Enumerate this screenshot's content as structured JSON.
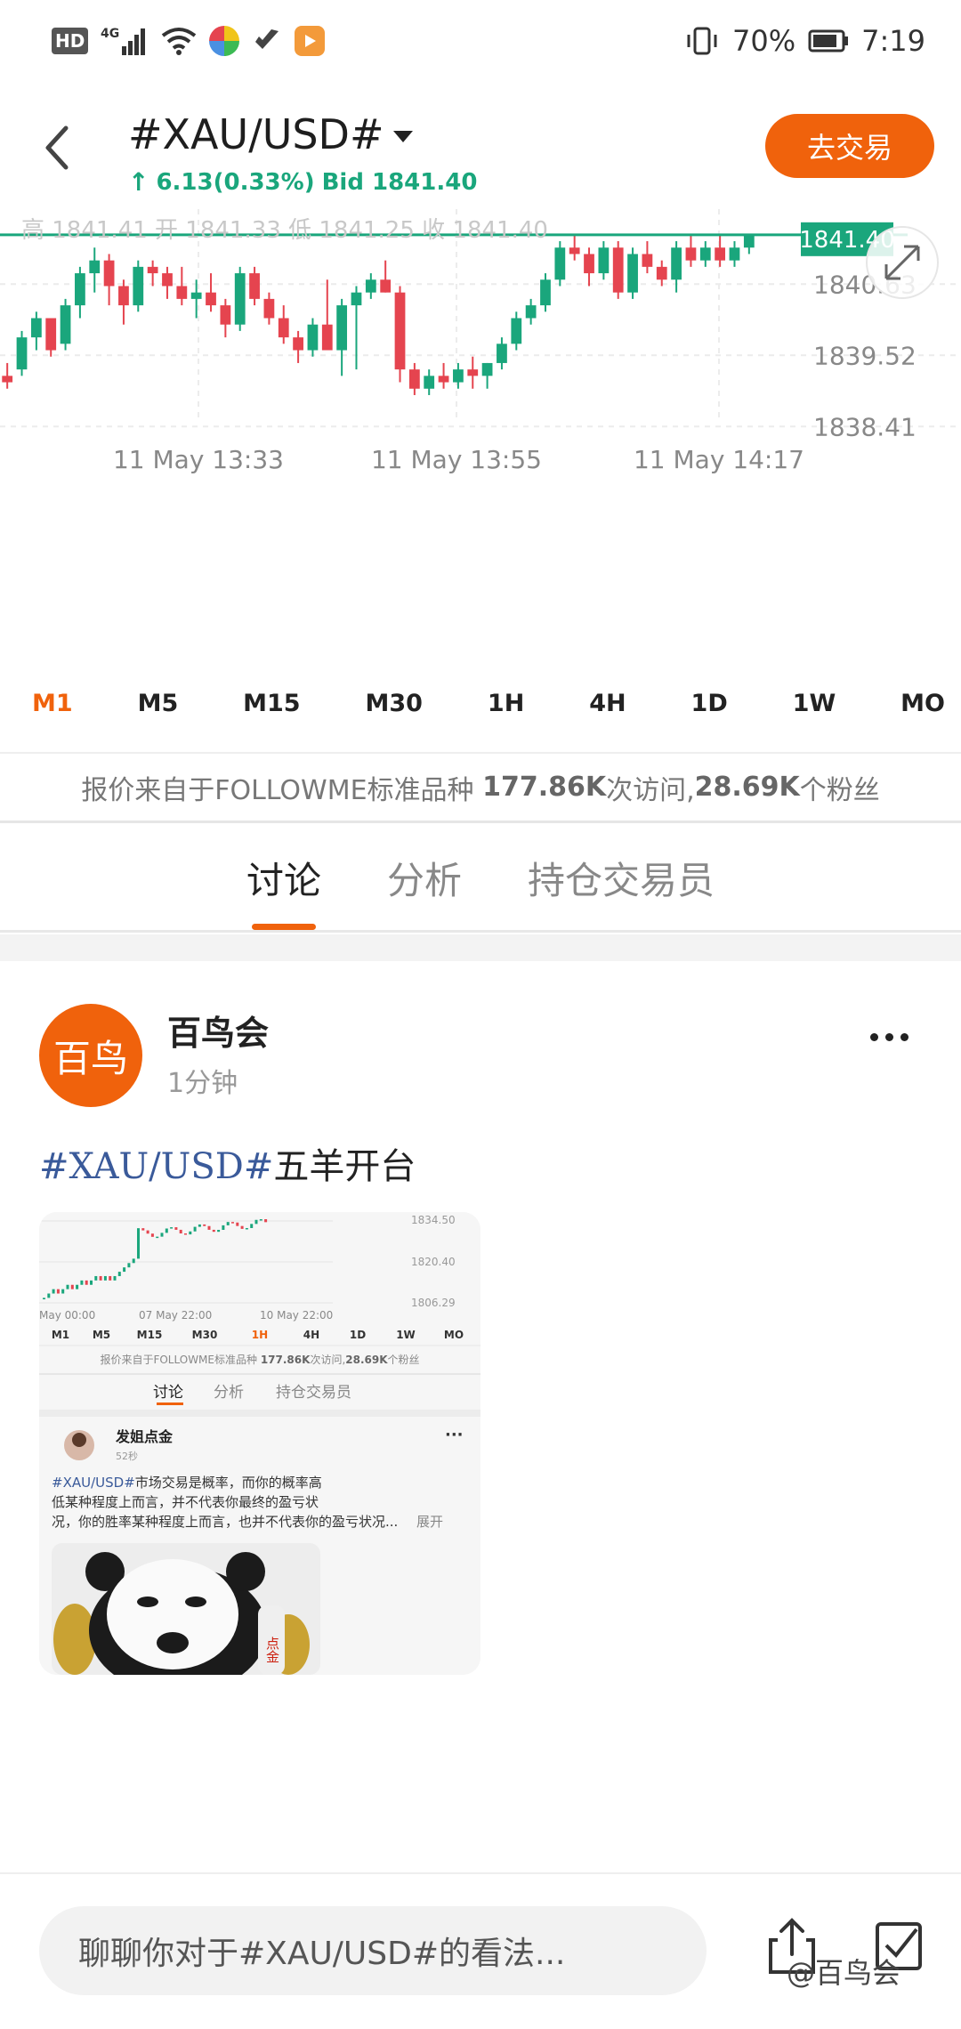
{
  "status_bar": {
    "network": "4G",
    "battery": "70%",
    "time": "7:19",
    "hd_label": "HD"
  },
  "header": {
    "title": "#XAU/USD#",
    "change": "6.13(0.33%)",
    "bid": "Bid 1841.40",
    "trade_button": "去交易"
  },
  "chart_data": {
    "type": "candlestick",
    "ohlc_label": "高 1841.41  开 1841.33  低 1841.25  收 1841.40",
    "current_price": "1841.40",
    "y_ticks": [
      "1840.63",
      "1839.52",
      "1838.41"
    ],
    "x_ticks": [
      "11 May  13:33",
      "11 May  13:55",
      "11 May  14:17"
    ],
    "ylim": [
      1838.4,
      1841.8
    ],
    "candles": [
      [
        1839.2,
        1839.4,
        1839.0,
        1839.1
      ],
      [
        1839.3,
        1839.9,
        1839.2,
        1839.8
      ],
      [
        1839.8,
        1840.2,
        1839.6,
        1840.1
      ],
      [
        1840.1,
        1840.0,
        1839.5,
        1839.6
      ],
      [
        1839.7,
        1840.4,
        1839.6,
        1840.3
      ],
      [
        1840.3,
        1840.9,
        1840.1,
        1840.8
      ],
      [
        1840.8,
        1841.2,
        1840.5,
        1841.0
      ],
      [
        1841.0,
        1841.1,
        1840.3,
        1840.6
      ],
      [
        1840.6,
        1840.7,
        1840.0,
        1840.3
      ],
      [
        1840.3,
        1841.0,
        1840.2,
        1840.9
      ],
      [
        1840.9,
        1841.0,
        1840.6,
        1840.8
      ],
      [
        1840.8,
        1840.9,
        1840.4,
        1840.6
      ],
      [
        1840.6,
        1840.9,
        1840.3,
        1840.4
      ],
      [
        1840.4,
        1840.7,
        1840.1,
        1840.5
      ],
      [
        1840.5,
        1840.8,
        1840.2,
        1840.3
      ],
      [
        1840.3,
        1840.4,
        1839.8,
        1840.0
      ],
      [
        1840.0,
        1840.9,
        1839.9,
        1840.8
      ],
      [
        1840.8,
        1840.9,
        1840.3,
        1840.4
      ],
      [
        1840.4,
        1840.5,
        1840.0,
        1840.1
      ],
      [
        1840.1,
        1840.3,
        1839.7,
        1839.8
      ],
      [
        1839.8,
        1839.9,
        1839.4,
        1839.6
      ],
      [
        1839.6,
        1840.1,
        1839.5,
        1840.0
      ],
      [
        1840.0,
        1840.7,
        1839.6,
        1839.6
      ],
      [
        1839.6,
        1840.4,
        1839.2,
        1840.3
      ],
      [
        1840.3,
        1840.6,
        1839.3,
        1840.5
      ],
      [
        1840.5,
        1840.8,
        1840.4,
        1840.7
      ],
      [
        1840.7,
        1841.0,
        1840.5,
        1840.5
      ],
      [
        1840.5,
        1840.6,
        1839.1,
        1839.3
      ],
      [
        1839.3,
        1839.4,
        1838.9,
        1839.0
      ],
      [
        1839.0,
        1839.3,
        1838.9,
        1839.2
      ],
      [
        1839.2,
        1839.4,
        1839.0,
        1839.1
      ],
      [
        1839.1,
        1839.4,
        1839.0,
        1839.3
      ],
      [
        1839.3,
        1839.5,
        1839.0,
        1839.2
      ],
      [
        1839.2,
        1839.4,
        1839.0,
        1839.4
      ],
      [
        1839.4,
        1839.8,
        1839.3,
        1839.7
      ],
      [
        1839.7,
        1840.2,
        1839.6,
        1840.1
      ],
      [
        1840.1,
        1840.4,
        1840.0,
        1840.3
      ],
      [
        1840.3,
        1840.8,
        1840.2,
        1840.7
      ],
      [
        1840.7,
        1841.3,
        1840.6,
        1841.2
      ],
      [
        1841.2,
        1841.4,
        1841.0,
        1841.1
      ],
      [
        1841.1,
        1841.2,
        1840.6,
        1840.8
      ],
      [
        1840.8,
        1841.3,
        1840.7,
        1841.2
      ],
      [
        1841.2,
        1841.3,
        1840.4,
        1840.5
      ],
      [
        1840.5,
        1841.2,
        1840.4,
        1841.1
      ],
      [
        1841.1,
        1841.3,
        1840.8,
        1840.9
      ],
      [
        1840.9,
        1841.0,
        1840.6,
        1840.7
      ],
      [
        1840.7,
        1841.3,
        1840.5,
        1841.2
      ],
      [
        1841.2,
        1841.4,
        1840.9,
        1841.0
      ],
      [
        1841.0,
        1841.3,
        1840.9,
        1841.2
      ],
      [
        1841.2,
        1841.4,
        1840.9,
        1841.0
      ],
      [
        1841.0,
        1841.3,
        1840.9,
        1841.2
      ],
      [
        1841.2,
        1841.4,
        1841.1,
        1841.4
      ]
    ]
  },
  "timeframes": [
    "M1",
    "M5",
    "M15",
    "M30",
    "1H",
    "4H",
    "1D",
    "1W",
    "MO"
  ],
  "source_info": {
    "prefix": "报价来自于FOLLOWME标准品种",
    "visits": "177.86K",
    "visits_suffix": "次访问,",
    "fans": "28.69K",
    "fans_suffix": "个粉丝"
  },
  "tabs": [
    "讨论",
    "分析",
    "持仓交易员"
  ],
  "post": {
    "avatar_text": "百鸟",
    "author": "百鸟会",
    "time": "1分钟",
    "tag": "#XAU/USD#",
    "text": "五羊开台"
  },
  "thumbnail": {
    "y_ticks": [
      "1834.50",
      "1820.40",
      "1806.29"
    ],
    "x_ticks": [
      "May  00:00",
      "07 May  22:00",
      "10 May  22:00"
    ],
    "timeframes": [
      "M1",
      "M5",
      "M15",
      "M30",
      "1H",
      "4H",
      "1D",
      "1W",
      "MO"
    ],
    "source_prefix": "报价来自于FOLLOWME标准品种",
    "source_visits": "177.86K",
    "source_visits_suffix": "次访问,",
    "source_fans": "28.69K",
    "source_fans_suffix": "个粉丝",
    "tabs": [
      "讨论",
      "分析",
      "持仓交易员"
    ],
    "author": "发姐点金",
    "time": "52秒",
    "tag": "#XAU/USD#",
    "body": "市场交易是概率，而你的概率高低某种程度上而言，并不代表你最终的盈亏状况，你的胜率某种程度上而言，也并不代表你的盈亏状况...",
    "expand": "展开",
    "meme_text": "点金"
  },
  "bottom_bar": {
    "comment_placeholder": "聊聊你对于#XAU/USD#的看法...",
    "watermark": "@百鸟会"
  },
  "colors": {
    "accent": "#f0620c",
    "up": "#1aa67c",
    "down": "#e5444f"
  }
}
